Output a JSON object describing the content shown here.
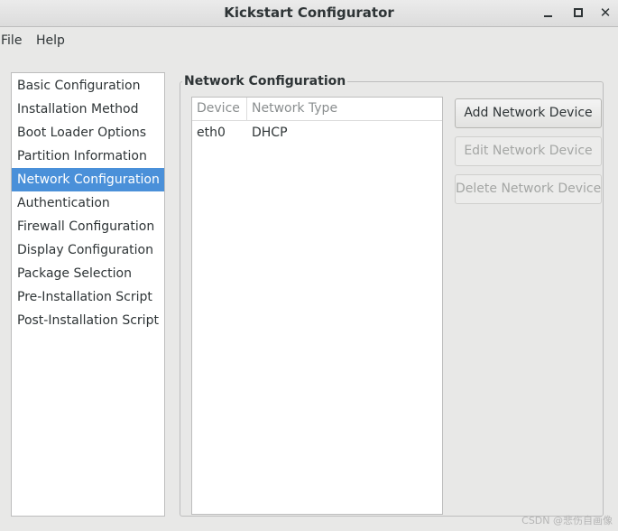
{
  "window": {
    "title": "Kickstart Configurator",
    "controls": [
      "minimize-icon",
      "maximize-icon",
      "close-icon"
    ]
  },
  "menubar": {
    "items": [
      {
        "label": "File"
      },
      {
        "label": "Help"
      }
    ]
  },
  "sidebar": {
    "selected": "Network Configuration",
    "items": [
      {
        "label": "Basic Configuration"
      },
      {
        "label": "Installation Method"
      },
      {
        "label": "Boot Loader Options"
      },
      {
        "label": "Partition Information"
      },
      {
        "label": "Network Configuration"
      },
      {
        "label": "Authentication"
      },
      {
        "label": "Firewall Configuration"
      },
      {
        "label": "Display Configuration"
      },
      {
        "label": "Package Selection"
      },
      {
        "label": "Pre-Installation Script"
      },
      {
        "label": "Post-Installation Script"
      }
    ]
  },
  "network": {
    "frame_title": "Network Configuration",
    "columns": [
      "Device",
      "Network Type"
    ],
    "rows": [
      {
        "device": "eth0",
        "type": "DHCP"
      }
    ],
    "buttons": {
      "add": "Add Network Device",
      "edit": "Edit Network Device",
      "delete": "Delete Network Device"
    }
  },
  "watermark": "CSDN @悲伤自画像",
  "colors": {
    "selection": "#4a90d9",
    "window_bg": "#e8e8e7"
  }
}
